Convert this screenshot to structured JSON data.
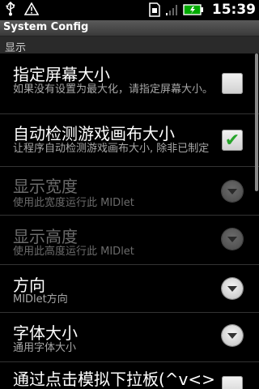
{
  "status_bar": {
    "time": "15:39"
  },
  "title_bar": {
    "title": "System Config"
  },
  "category": {
    "label": "显示"
  },
  "preferences": [
    {
      "title": "指定屏幕大小",
      "summary": "如果没有设置为最大化，请指定屏幕大小。",
      "widget": "checkbox",
      "checked": false,
      "enabled": true
    },
    {
      "title": "自动检测游戏画布大小",
      "summary": "让程序自动检测游戏画布大小, 除非已制定",
      "widget": "checkbox",
      "checked": true,
      "enabled": true
    },
    {
      "title": "显示宽度",
      "summary": "使用此宽度运行此 MIDlet",
      "widget": "dropdown",
      "enabled": false
    },
    {
      "title": "显示高度",
      "summary": "使用此高度运行此 MIDlet",
      "widget": "dropdown",
      "enabled": false
    },
    {
      "title": "方向",
      "summary": "MIDlet方向",
      "widget": "dropdown",
      "enabled": true
    },
    {
      "title": "字体大小",
      "summary": "通用字体大小",
      "widget": "dropdown",
      "enabled": true
    },
    {
      "title": "通过点击模拟下拉板(^v<>",
      "summary": "",
      "widget": "checkbox",
      "checked": false,
      "enabled": true
    }
  ],
  "colors": {
    "background": "#000000",
    "title_bar": "#4a4a4a",
    "check_green": "#27a52b"
  }
}
